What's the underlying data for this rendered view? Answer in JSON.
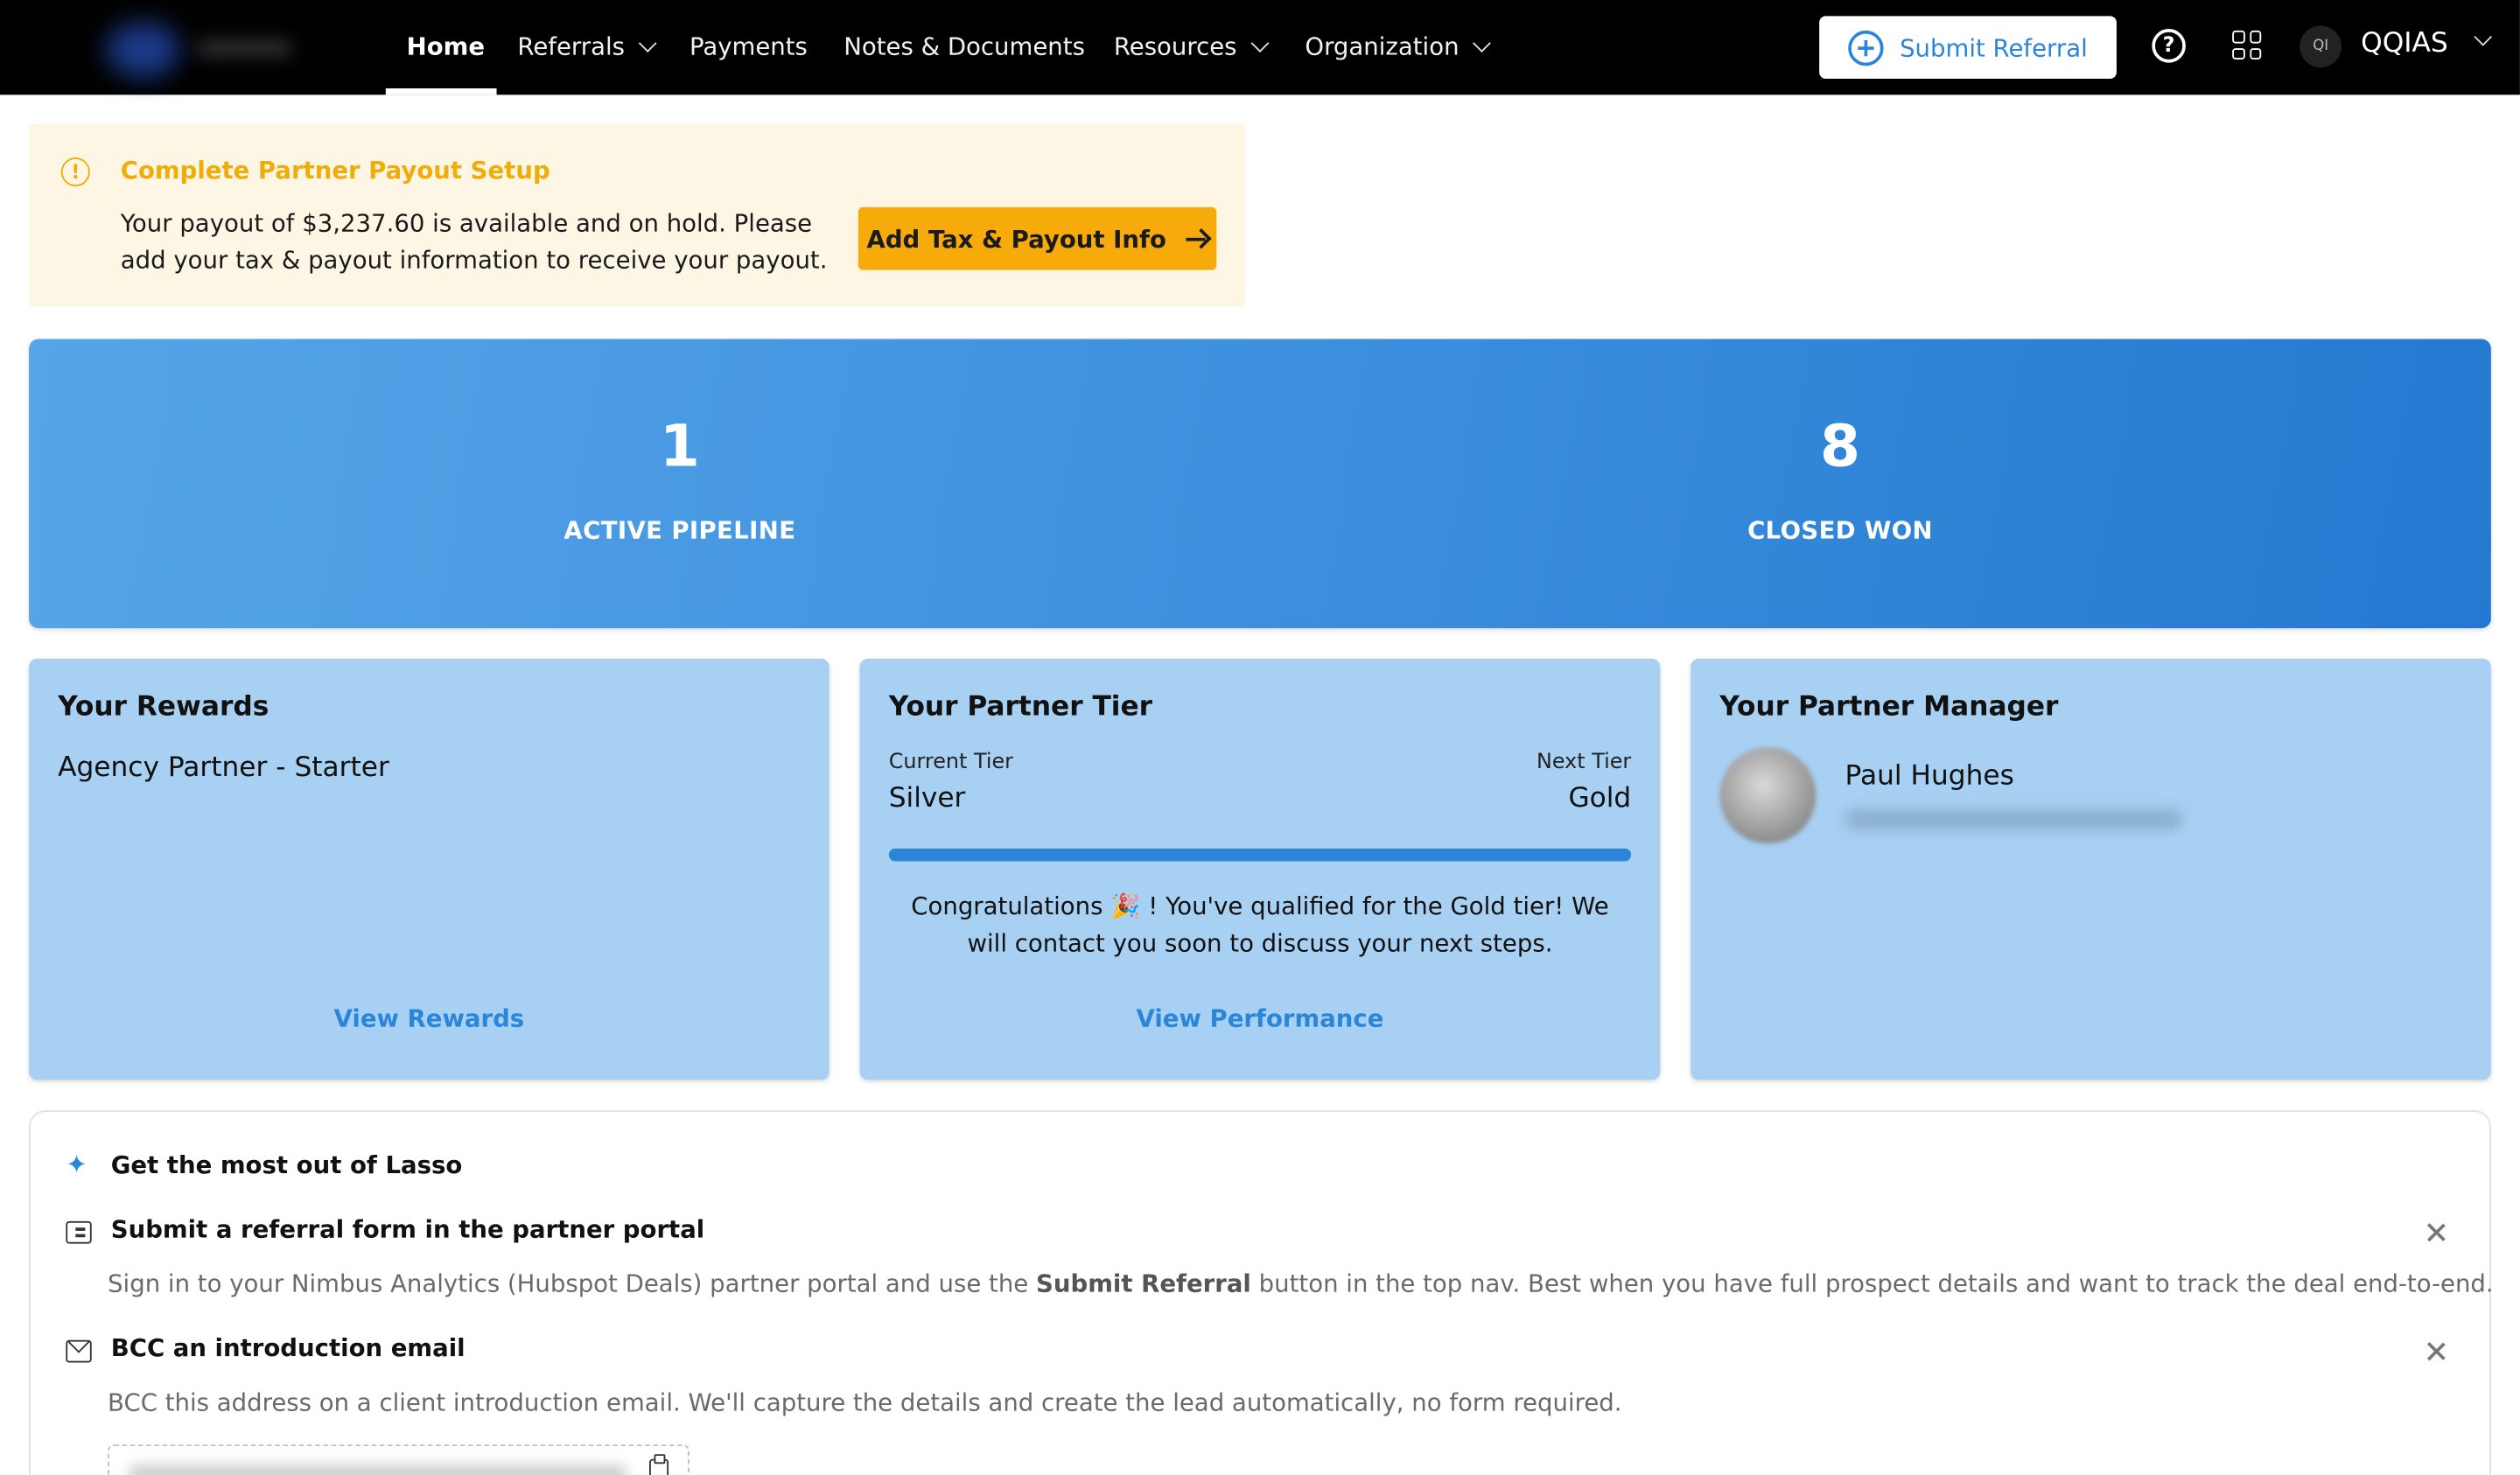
{
  "nav": {
    "items": [
      {
        "label": "Home",
        "active": true
      },
      {
        "label": "Referrals",
        "dropdown": true
      },
      {
        "label": "Payments"
      },
      {
        "label": "Notes & Documents"
      },
      {
        "label": "Resources",
        "dropdown": true
      },
      {
        "label": "Organization",
        "dropdown": true
      }
    ],
    "submit_label": "Submit Referral",
    "help_glyph": "?",
    "avatar_initials": "QI",
    "org_name": "QQIAS"
  },
  "alert": {
    "icon": "warning-circle-icon",
    "title": "Complete Partner Payout Setup",
    "body": "Your payout of $3,237.60 is available and on hold. Please add your tax & payout information to receive your payout.",
    "button_label": "Add Tax & Payout Info"
  },
  "stats": [
    {
      "value": "1",
      "label": "ACTIVE PIPELINE"
    },
    {
      "value": "8",
      "label": "CLOSED WON"
    }
  ],
  "rewards": {
    "title": "Your Rewards",
    "program": "Agency Partner - Starter",
    "link": "View Rewards"
  },
  "tier": {
    "title": "Your Partner Tier",
    "current_label": "Current Tier",
    "current_value": "Silver",
    "next_label": "Next Tier",
    "next_value": "Gold",
    "progress_percent": 100,
    "message": "Congratulations 🎉 ! You've qualified for the Gold tier! We will contact you soon to discuss your next steps.",
    "link": "View Performance"
  },
  "manager": {
    "title": "Your Partner Manager",
    "name": "Paul Hughes"
  },
  "tips": {
    "title": "Get the most out of Lasso",
    "items": [
      {
        "title": "Submit a referral form in the partner portal",
        "desc_before": "Sign in to your Nimbus Analytics (Hubspot Deals) partner portal and use the ",
        "desc_bold": "Submit Referral",
        "desc_after": " button in the top nav. Best when you have full prospect details and want to track the deal end-to-end."
      },
      {
        "title": "BCC an introduction email",
        "desc": "BCC this address on a client introduction email. We'll capture the details and create the lead automatically, no form required."
      }
    ]
  },
  "colors": {
    "accent": "#2b86d9",
    "warning": "#f0ad0a",
    "payout_button": "#f7ab0b",
    "card_bg": "#a8d0f3",
    "nav_bg": "#000000"
  }
}
